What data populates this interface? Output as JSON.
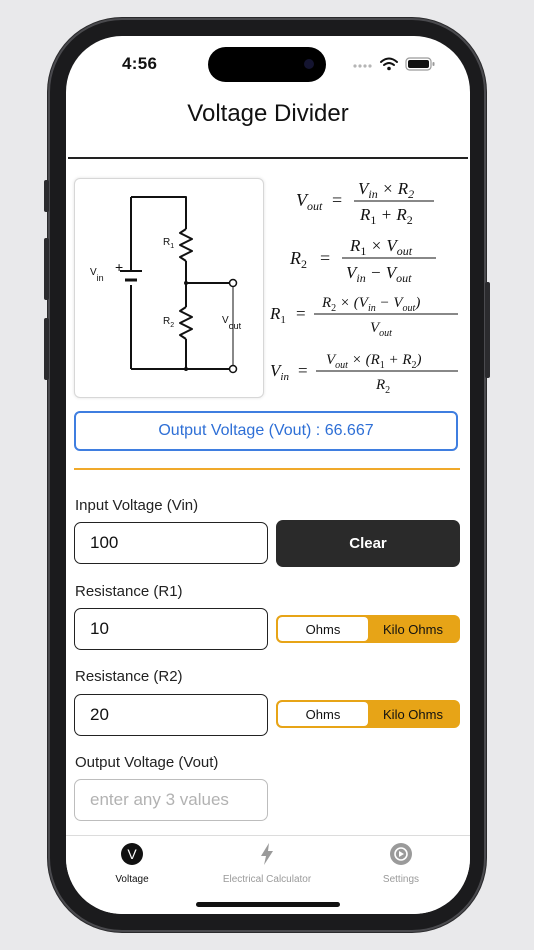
{
  "status": {
    "time": "4:56"
  },
  "header": {
    "title": "Voltage Divider"
  },
  "circuit": {
    "labels": {
      "r1": "R",
      "r1_sub": "1",
      "r2": "R",
      "r2_sub": "2",
      "vin": "V",
      "vin_sub": "in",
      "plus": "+",
      "vout": "V",
      "vout_sub": "out"
    }
  },
  "formulas": {
    "vout": {
      "lhs": "V",
      "lhs_sub": "out",
      "num": "V",
      "num_sub": "in",
      "num_op": " × R",
      "num_op_sub": "2",
      "den": "R",
      "den_sub": "1",
      "den_op": " + R",
      "den_op_sub": "2"
    },
    "r2": {
      "lhs": "R",
      "lhs_sub": "2",
      "num": "R",
      "num_sub": "1",
      "num_op": " × V",
      "num_op_sub": "out",
      "den": "V",
      "den_sub": "in",
      "den_op": " − V",
      "den_op_sub": "out"
    },
    "r1": {
      "lhs": "R",
      "lhs_sub": "1",
      "num": "R",
      "num_sub": "2",
      "num_op": " × (V",
      "num_op_sub": "in",
      "num_tail": " − V",
      "num_tail_sub": "out",
      "num_end": ")",
      "den": "V",
      "den_sub": "out"
    },
    "vin": {
      "lhs": "V",
      "lhs_sub": "in",
      "num": "V",
      "num_sub": "out",
      "num_op": " × (R",
      "num_op_sub": "1",
      "num_tail": " + R",
      "num_tail_sub": "2",
      "num_end": ")",
      "den": "R",
      "den_sub": "2"
    },
    "eq": "="
  },
  "result": {
    "text": "Output Voltage (Vout) : 66.667"
  },
  "form": {
    "vin": {
      "label": "Input Voltage (Vin)",
      "value": "100"
    },
    "clear_label": "Clear",
    "r1": {
      "label": "Resistance (R1)",
      "value": "10",
      "unit_ohms": "Ohms",
      "unit_kohms": "Kilo Ohms"
    },
    "r2": {
      "label": "Resistance (R2)",
      "value": "20",
      "unit_ohms": "Ohms",
      "unit_kohms": "Kilo Ohms"
    },
    "vout": {
      "label": "Output Voltage (Vout)",
      "placeholder": "enter any 3 values"
    }
  },
  "tabs": [
    {
      "label": "Voltage",
      "icon": "v-circle-icon",
      "glyph": "V",
      "active": true
    },
    {
      "label": "Electrical Calculator",
      "icon": "lightning-icon",
      "active": false
    },
    {
      "label": "Settings",
      "icon": "settings-icon",
      "active": false
    }
  ],
  "colors": {
    "accent_blue": "#3f7ee0",
    "accent_orange": "#e7a417",
    "dark_button": "#2a2a2a"
  }
}
